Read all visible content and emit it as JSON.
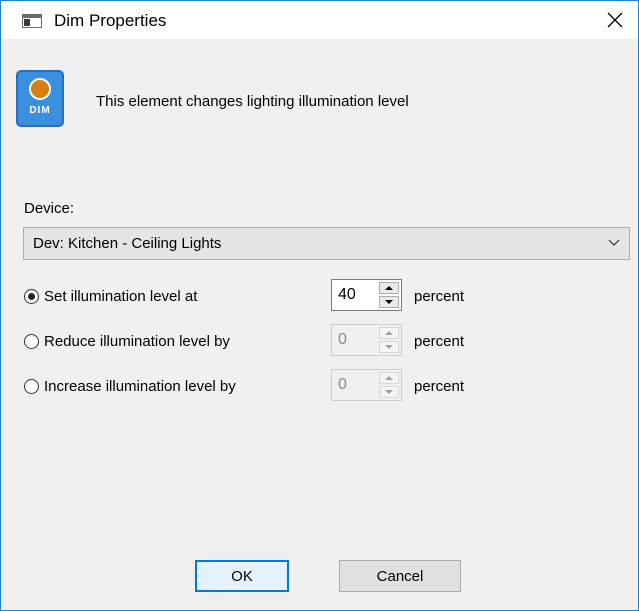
{
  "window": {
    "title": "Dim Properties",
    "icon": "window-icon",
    "close_icon": "close-icon"
  },
  "header": {
    "icon": "dim-icon",
    "icon_text": "DIM",
    "description": "This element changes lighting illumination level"
  },
  "device": {
    "label": "Device:",
    "selected": "Dev: Kitchen - Ceiling Lights"
  },
  "options": [
    {
      "label": "Set illumination level at",
      "checked": true,
      "value": "40",
      "unit": "percent",
      "enabled": true
    },
    {
      "label": "Reduce illumination level by",
      "checked": false,
      "value": "0",
      "unit": "percent",
      "enabled": false
    },
    {
      "label": "Increase illumination level by",
      "checked": false,
      "value": "0",
      "unit": "percent",
      "enabled": false
    }
  ],
  "buttons": {
    "ok": "OK",
    "cancel": "Cancel"
  },
  "colors": {
    "accent": "#0078d7",
    "icon_bg": "#3a8fde",
    "lamp": "#d67e10"
  }
}
